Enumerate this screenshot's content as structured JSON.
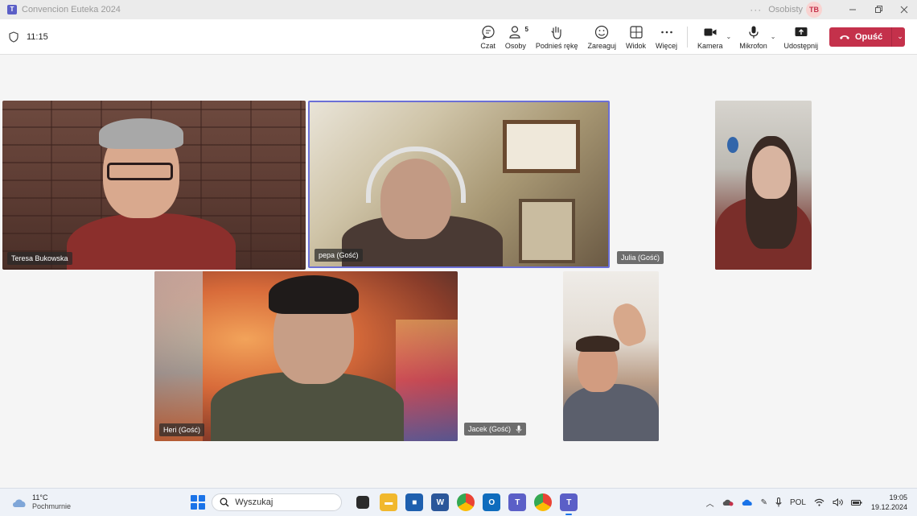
{
  "window": {
    "title": "Convencion Euteka 2024",
    "profile_label": "Osobisty",
    "profile_initials": "TB"
  },
  "toolbar": {
    "timer": "11:15",
    "chat_label": "Czat",
    "people_label": "Osoby",
    "people_count": "5",
    "raise_label": "Podnieś rękę",
    "react_label": "Zareaguj",
    "view_label": "Widok",
    "more_label": "Więcej",
    "camera_label": "Kamera",
    "mic_label": "Mikrofon",
    "share_label": "Udostępnij",
    "leave_label": "Opuść"
  },
  "participants": [
    {
      "name": "Teresa Bukowska"
    },
    {
      "name": "pepa (Gość)"
    },
    {
      "name": "Julia (Gość)"
    },
    {
      "name": "Heri (Gość)"
    },
    {
      "name": "Jacek (Gość)"
    }
  ],
  "taskbar": {
    "weather_temp": "11°C",
    "weather_desc": "Pochmurnie",
    "search_placeholder": "Wyszukaj",
    "language": "POL",
    "time": "19:05",
    "date": "19.12.2024"
  },
  "colors": {
    "accent": "#5b5fc7",
    "leave_red": "#c4314b",
    "active_speaker_border": "#6b6fd6"
  }
}
